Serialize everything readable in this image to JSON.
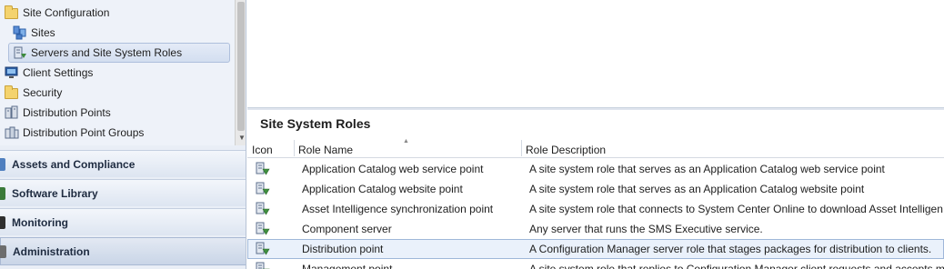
{
  "tree": {
    "items": [
      {
        "label": "Site Configuration",
        "icon": "folder-icon"
      },
      {
        "label": "Sites",
        "icon": "sites-icon"
      },
      {
        "label": "Servers and Site System Roles",
        "icon": "server-roles-icon"
      },
      {
        "label": "Client Settings",
        "icon": "client-settings-icon"
      },
      {
        "label": "Security",
        "icon": "folder-icon"
      },
      {
        "label": "Distribution Points",
        "icon": "distribution-points-icon"
      },
      {
        "label": "Distribution Point Groups",
        "icon": "distribution-point-groups-icon"
      }
    ]
  },
  "workspaces": [
    {
      "label": "Assets and Compliance",
      "icon": "assets-icon"
    },
    {
      "label": "Software Library",
      "icon": "software-library-icon"
    },
    {
      "label": "Monitoring",
      "icon": "monitoring-icon"
    },
    {
      "label": "Administration",
      "icon": "administration-icon"
    }
  ],
  "section": {
    "title": "Site System Roles"
  },
  "grid": {
    "columns": [
      "Icon",
      "Role Name",
      "Role Description"
    ],
    "rows": [
      {
        "name": "Application Catalog web service point",
        "description": "A site system role that serves as an Application Catalog web service point"
      },
      {
        "name": "Application Catalog website point",
        "description": "A site system role that serves as an Application Catalog website point"
      },
      {
        "name": "Asset Intelligence synchronization point",
        "description": "A site system role that connects to System Center Online to download Asset Intelligen"
      },
      {
        "name": "Component server",
        "description": "Any server that runs the SMS Executive service."
      },
      {
        "name": "Distribution point",
        "description": "A Configuration Manager server role that stages packages for distribution to clients."
      },
      {
        "name": "Management point",
        "description": "A site system role that replies to Configuration Manager client requests and accepts m"
      }
    ]
  },
  "colors": {
    "nav_bg": "#e9eef6",
    "selection_border": "#9fb7d9",
    "selection_bg": "#eaf1fb"
  }
}
